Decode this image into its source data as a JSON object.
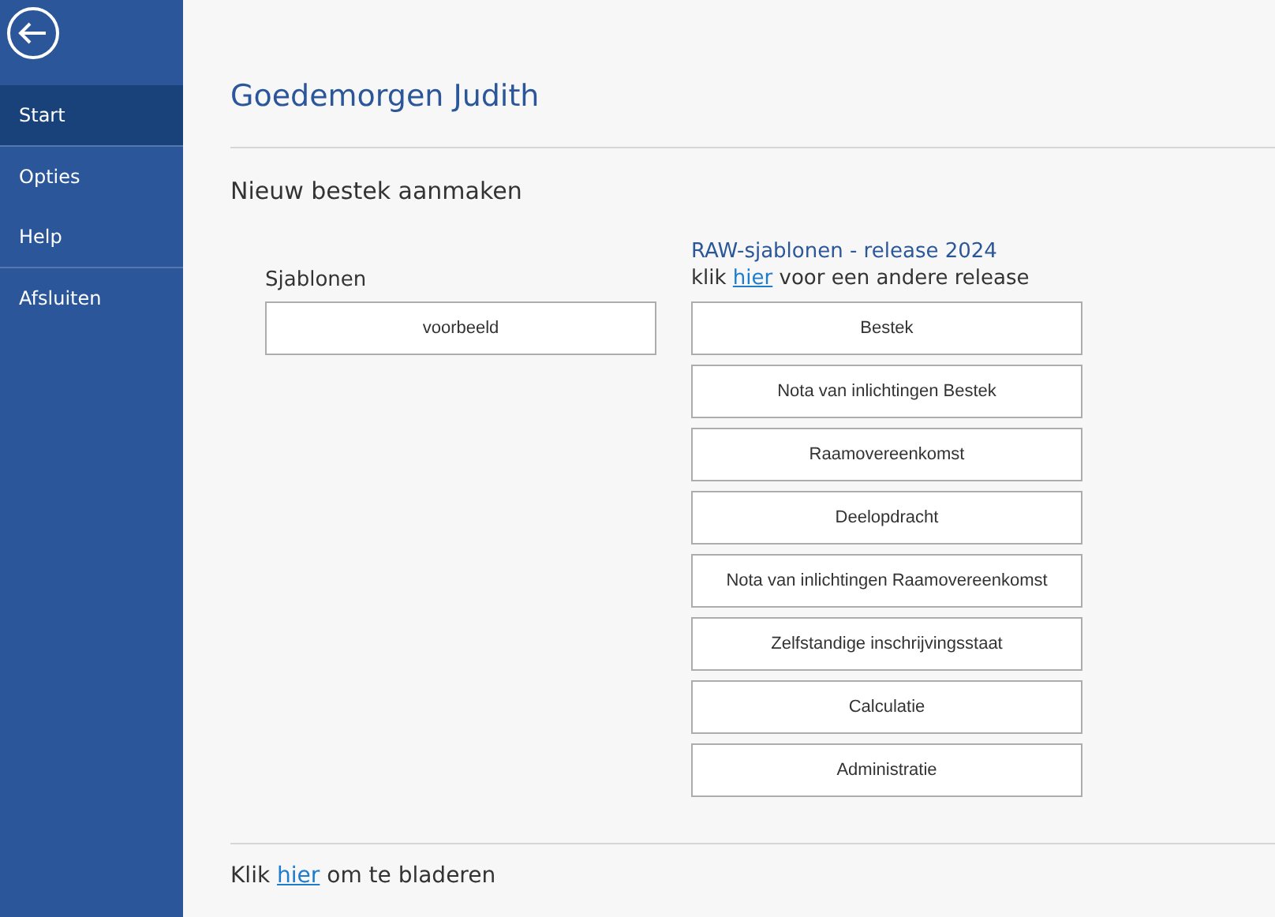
{
  "sidebar": {
    "back_button": {
      "kind": "back"
    },
    "items": [
      {
        "label": "Start",
        "selected": true,
        "separator_after": true
      },
      {
        "label": "Opties",
        "selected": false,
        "separator_after": false
      },
      {
        "label": "Help",
        "selected": false,
        "separator_after": true
      },
      {
        "label": "Afsluiten",
        "selected": false,
        "separator_after": false
      }
    ]
  },
  "greeting": "Goedemorgen Judith",
  "section_title": "Nieuw bestek aanmaken",
  "templates": {
    "heading": "Sjablonen",
    "buttons": [
      "voorbeeld"
    ]
  },
  "raw_templates": {
    "heading": "RAW-sjablonen - release 2024",
    "note": {
      "prefix": "klik ",
      "link": "hier",
      "suffix": " voor een andere release"
    },
    "buttons": [
      "Bestek",
      "Nota van inlichtingen Bestek",
      "Raamovereenkomst",
      "Deelopdracht",
      "Nota van inlichtingen Raamovereenkomst",
      "Zelfstandige inschrijvingsstaat",
      "Calculatie",
      "Administratie"
    ]
  },
  "browse": {
    "prefix": "Klik ",
    "link": "hier",
    "suffix": " om te bladeren"
  }
}
